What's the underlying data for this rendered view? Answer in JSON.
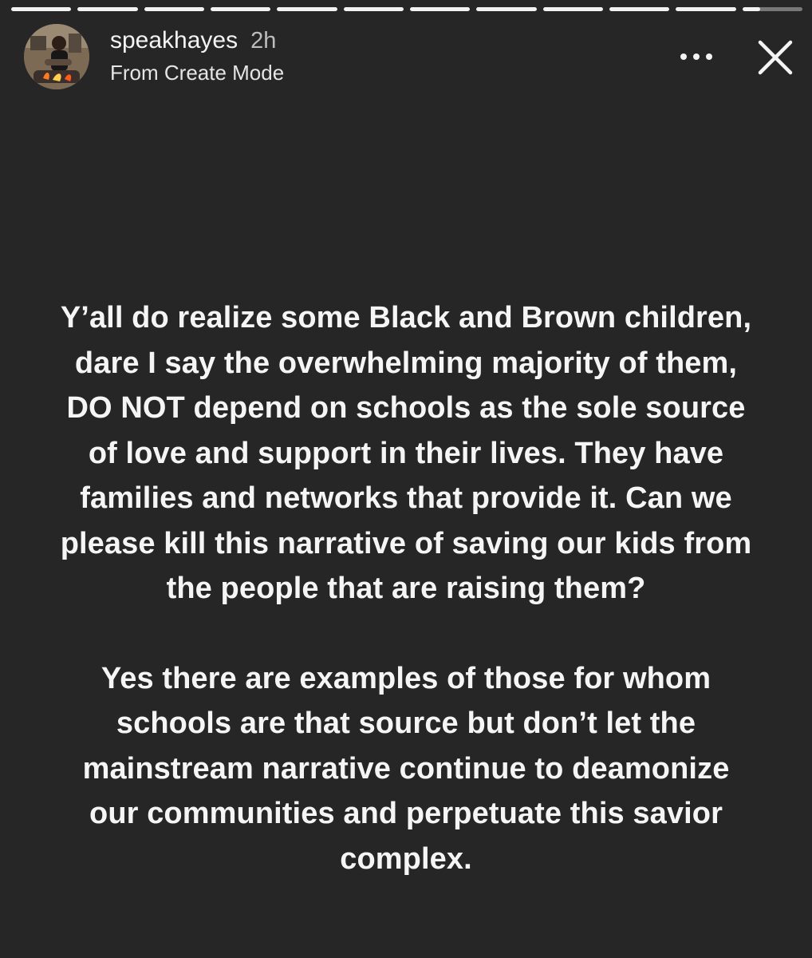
{
  "story": {
    "username": "speakhayes",
    "time": "2h",
    "subtitle": "From Create Mode",
    "progress": {
      "segments_total": 12,
      "segments_complete": 11,
      "current_segment_progress": 0.3
    },
    "icons": {
      "more": "more-horizontal-icon",
      "close": "close-icon"
    },
    "paragraphs": [
      "Y’all do realize some Black and Brown children, dare I say the overwhelming majority of them, DO NOT depend on schools as the sole source of love and support in their lives. They have families and networks that provide it. Can we please kill this narrative of saving our kids from the people that are raising them?",
      "Yes there are examples of those for whom schools are that source but don’t let the mainstream narrative continue to deamonize our communities and perpetuate this savior complex."
    ]
  }
}
